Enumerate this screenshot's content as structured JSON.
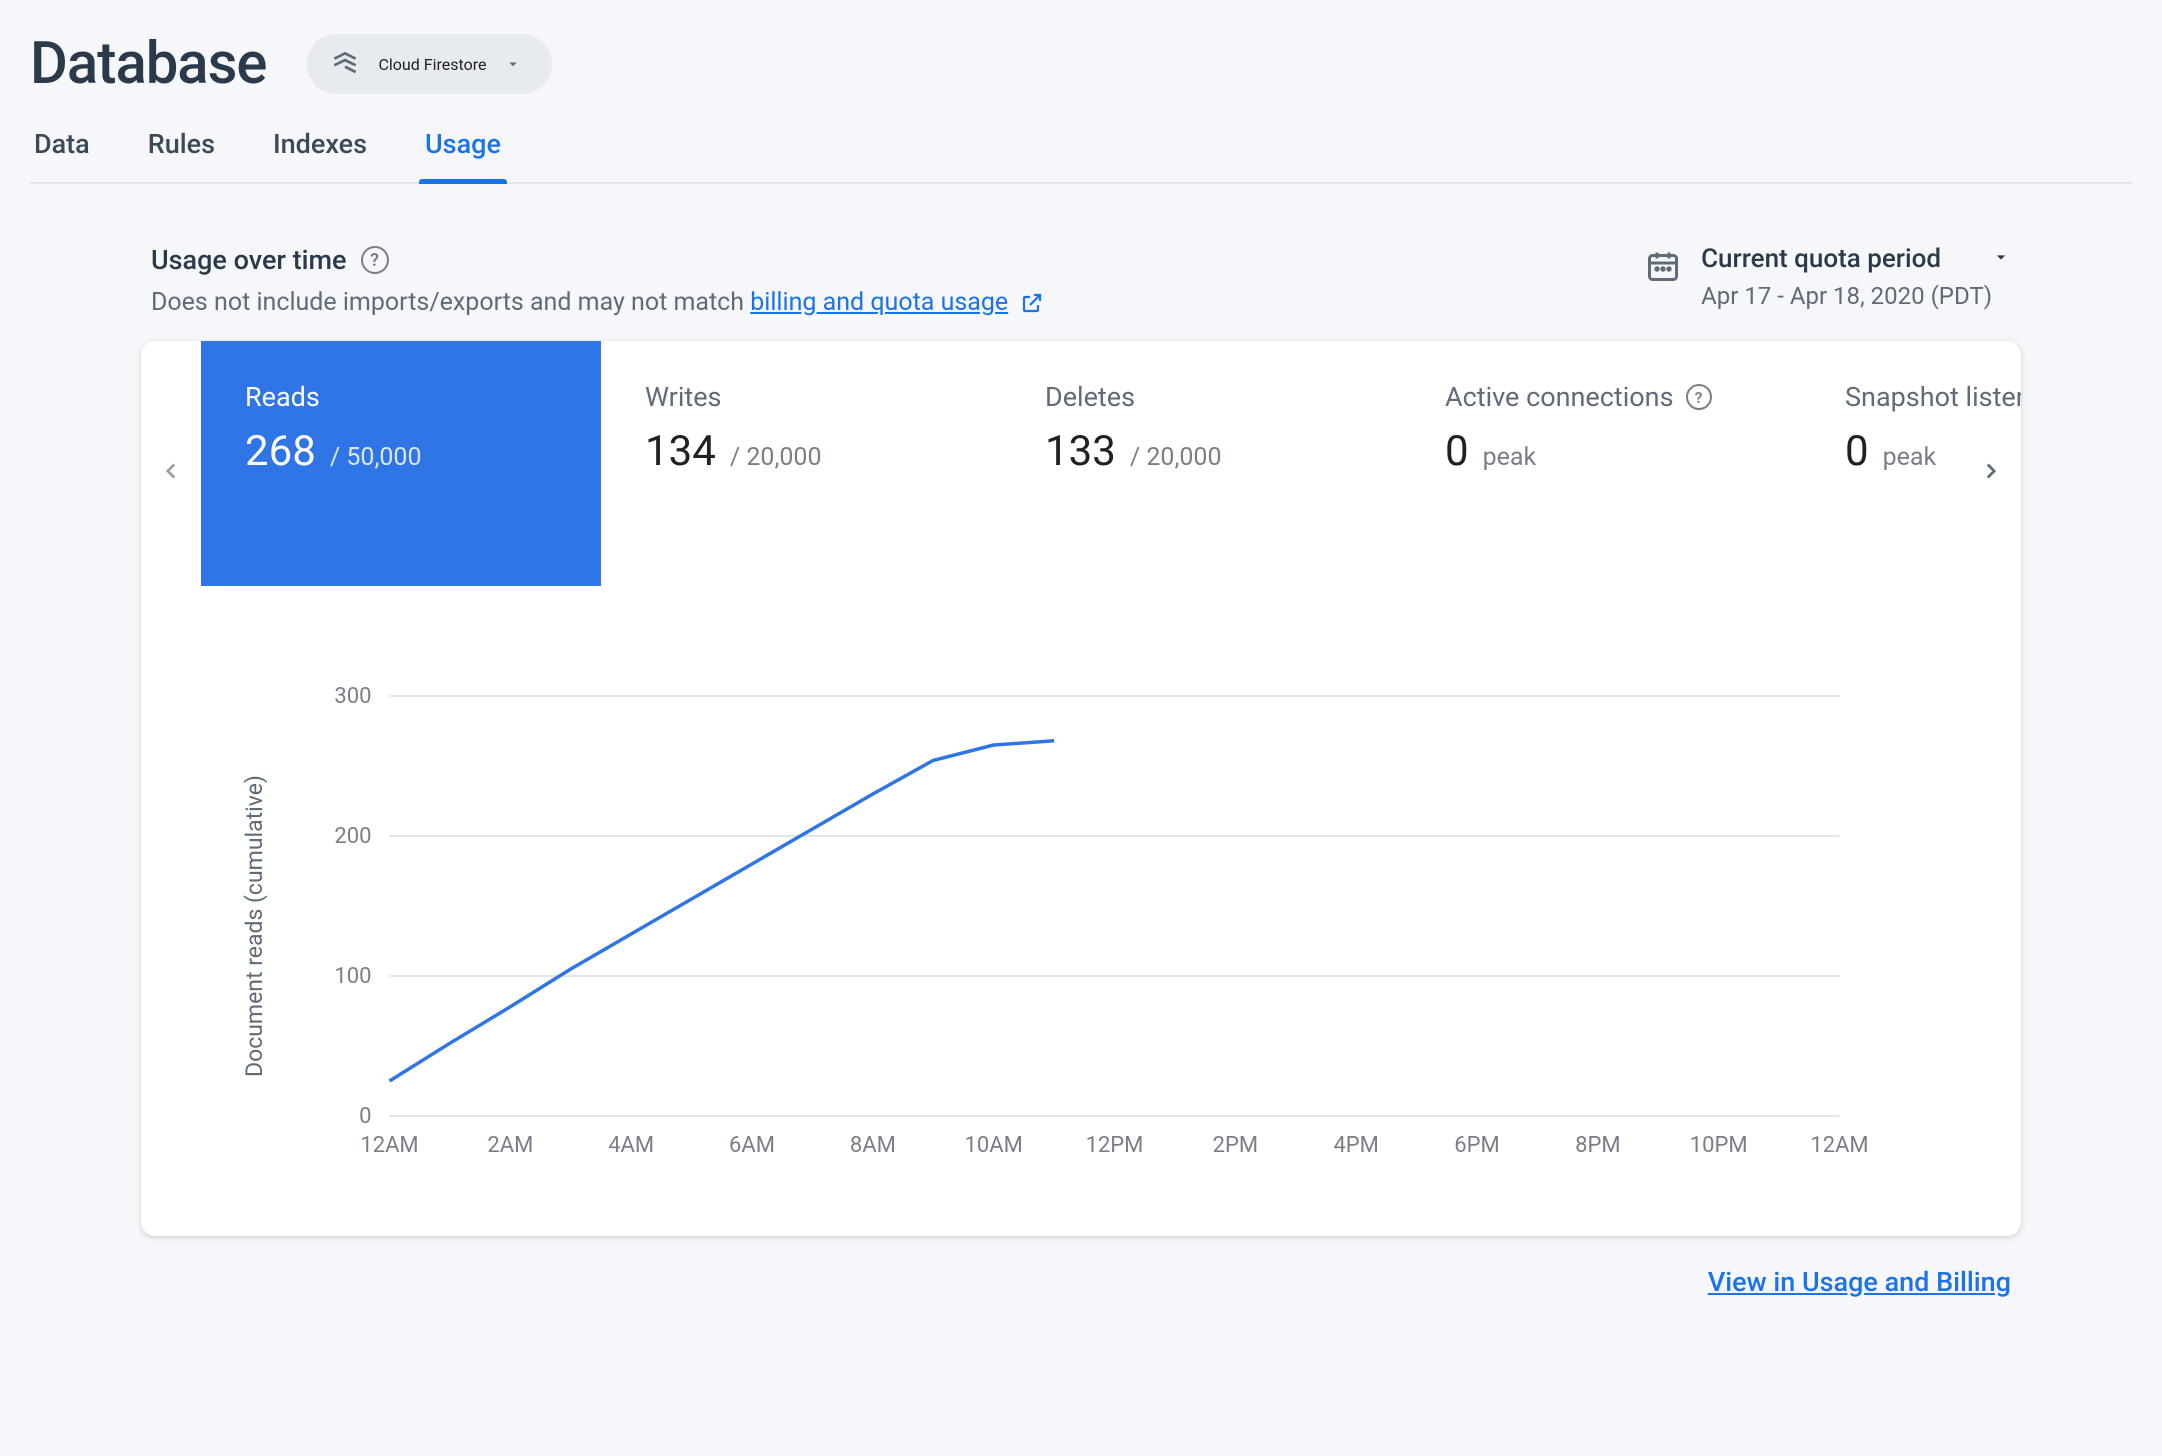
{
  "header": {
    "title": "Database",
    "db_selector_label": "Cloud Firestore"
  },
  "tabs": [
    {
      "label": "Data",
      "active": false
    },
    {
      "label": "Rules",
      "active": false
    },
    {
      "label": "Indexes",
      "active": false
    },
    {
      "label": "Usage",
      "active": true
    }
  ],
  "usage_header": {
    "title": "Usage over time",
    "subtitle_prefix": "Does not include imports/exports and may not match ",
    "subtitle_link": "billing and quota usage"
  },
  "period": {
    "label": "Current quota period",
    "date_range": "Apr 17 - Apr 18, 2020 (PDT)"
  },
  "metrics": [
    {
      "label": "Reads",
      "value": "268",
      "limit": "/ 50,000",
      "active": true,
      "has_help": false
    },
    {
      "label": "Writes",
      "value": "134",
      "limit": "/ 20,000",
      "active": false,
      "has_help": false
    },
    {
      "label": "Deletes",
      "value": "133",
      "limit": "/ 20,000",
      "active": false,
      "has_help": false
    },
    {
      "label": "Active connections",
      "value": "0",
      "limit": "peak",
      "active": false,
      "has_help": true
    },
    {
      "label": "Snapshot listeners",
      "value": "0",
      "limit": "peak",
      "active": false,
      "has_help": true
    }
  ],
  "footer": {
    "link_text": "View in Usage and Billing"
  },
  "chart_data": {
    "type": "line",
    "title": "",
    "xlabel": "",
    "ylabel": "Document reads (cumulative)",
    "ylim": [
      0,
      300
    ],
    "y_ticks": [
      0,
      100,
      200,
      300
    ],
    "x_ticks": [
      "12AM",
      "2AM",
      "4AM",
      "6AM",
      "8AM",
      "10AM",
      "12PM",
      "2PM",
      "4PM",
      "6PM",
      "8PM",
      "10PM",
      "12AM"
    ],
    "series": [
      {
        "name": "Reads",
        "x": [
          "12AM",
          "1AM",
          "2AM",
          "3AM",
          "4AM",
          "5AM",
          "6AM",
          "7AM",
          "8AM",
          "9AM",
          "10AM",
          "11AM"
        ],
        "values": [
          25,
          52,
          78,
          105,
          130,
          155,
          180,
          205,
          230,
          254,
          265,
          268
        ]
      }
    ]
  }
}
